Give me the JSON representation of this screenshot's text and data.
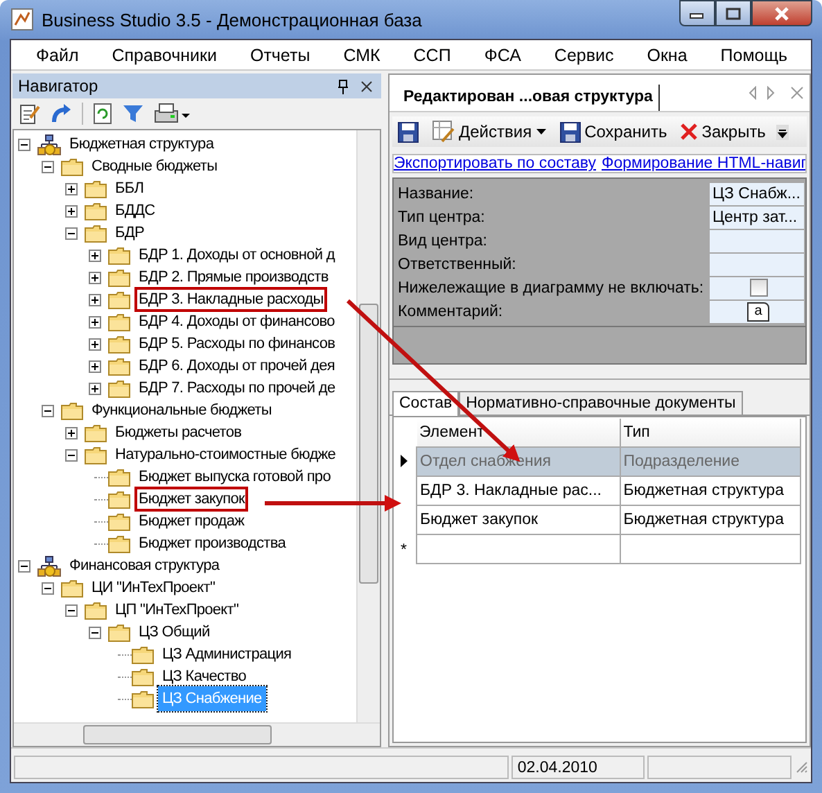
{
  "window": {
    "title": "Business Studio 3.5 - Демонстрационная база"
  },
  "menu": [
    "Файл",
    "Справочники",
    "Отчеты",
    "СМК",
    "ССП",
    "ФСА",
    "Сервис",
    "Окна",
    "Помощь"
  ],
  "navigator": {
    "title": "Навигатор",
    "tree": [
      {
        "label": "Бюджетная структура",
        "kind": "structure",
        "expanded": true,
        "selected": false,
        "highlighted": false,
        "children": [
          {
            "label": "Сводные бюджеты",
            "kind": "folder",
            "expanded": true,
            "selected": false,
            "highlighted": false,
            "children": [
              {
                "label": "ББЛ",
                "kind": "folder",
                "expanded": false,
                "selected": false,
                "highlighted": false
              },
              {
                "label": "БДДС",
                "kind": "folder",
                "expanded": false,
                "selected": false,
                "highlighted": false
              },
              {
                "label": "БДР",
                "kind": "folder",
                "expanded": true,
                "selected": false,
                "highlighted": false,
                "children": [
                  {
                    "label": "БДР 1. Доходы от основной д",
                    "kind": "folder",
                    "expanded": false,
                    "selected": false,
                    "highlighted": false
                  },
                  {
                    "label": "БДР 2. Прямые производств",
                    "kind": "folder",
                    "expanded": false,
                    "selected": false,
                    "highlighted": false
                  },
                  {
                    "label": "БДР 3. Накладные расходы",
                    "kind": "folder",
                    "expanded": false,
                    "selected": false,
                    "highlighted": true
                  },
                  {
                    "label": "БДР 4. Доходы от финансово",
                    "kind": "folder",
                    "expanded": false,
                    "selected": false,
                    "highlighted": false
                  },
                  {
                    "label": "БДР 5. Расходы по финансов",
                    "kind": "folder",
                    "expanded": false,
                    "selected": false,
                    "highlighted": false
                  },
                  {
                    "label": "БДР 6. Доходы от прочей дея",
                    "kind": "folder",
                    "expanded": false,
                    "selected": false,
                    "highlighted": false
                  },
                  {
                    "label": "БДР 7. Расходы по прочей де",
                    "kind": "folder",
                    "expanded": false,
                    "selected": false,
                    "highlighted": false
                  }
                ]
              }
            ]
          },
          {
            "label": "Функциональные бюджеты",
            "kind": "folder",
            "expanded": true,
            "selected": false,
            "highlighted": false,
            "children": [
              {
                "label": "Бюджеты расчетов",
                "kind": "folder",
                "expanded": false,
                "selected": false,
                "highlighted": false
              },
              {
                "label": "Натурально-стоимостные бюдже",
                "kind": "folder",
                "expanded": true,
                "selected": false,
                "highlighted": false,
                "children": [
                  {
                    "label": "Бюджет выпуска готовой про",
                    "kind": "leaf",
                    "selected": false,
                    "highlighted": false
                  },
                  {
                    "label": "Бюджет закупок",
                    "kind": "leaf",
                    "selected": false,
                    "highlighted": true
                  },
                  {
                    "label": "Бюджет продаж",
                    "kind": "leaf",
                    "selected": false,
                    "highlighted": false
                  },
                  {
                    "label": "Бюджет производства",
                    "kind": "leaf",
                    "selected": false,
                    "highlighted": false
                  }
                ]
              }
            ]
          }
        ]
      },
      {
        "label": "Финансовая структура",
        "kind": "structure",
        "expanded": true,
        "selected": false,
        "highlighted": false,
        "children": [
          {
            "label": "ЦИ \"ИнТехПроект\"",
            "kind": "folder",
            "expanded": true,
            "selected": false,
            "highlighted": false,
            "children": [
              {
                "label": "ЦП \"ИнТехПроект\"",
                "kind": "folder",
                "expanded": true,
                "selected": false,
                "highlighted": false,
                "children": [
                  {
                    "label": "ЦЗ Общий",
                    "kind": "folder",
                    "expanded": true,
                    "selected": false,
                    "highlighted": false,
                    "children": [
                      {
                        "label": "ЦЗ Администрация",
                        "kind": "leaf",
                        "selected": false,
                        "highlighted": false
                      },
                      {
                        "label": "ЦЗ Качество",
                        "kind": "leaf",
                        "selected": false,
                        "highlighted": false
                      },
                      {
                        "label": "ЦЗ Снабжение",
                        "kind": "leaf",
                        "selected": true,
                        "highlighted": false
                      }
                    ]
                  }
                ]
              }
            ]
          }
        ]
      }
    ]
  },
  "document": {
    "tab": "Редактирован ...овая  структура",
    "toolbar": [
      {
        "kind": "save"
      },
      {
        "kind": "menu",
        "label": "Действия"
      },
      {
        "kind": "save",
        "label": "Сохранить"
      },
      {
        "kind": "close",
        "label": "Закрыть"
      }
    ],
    "links": [
      "Экспортировать по составу",
      "Формирование HTML-навиг"
    ],
    "properties": [
      {
        "label": "Название:",
        "kind": "text",
        "value": "ЦЗ Снабж..."
      },
      {
        "label": "Тип центра:",
        "kind": "text",
        "value": "Центр зат..."
      },
      {
        "label": "Вид центра:",
        "kind": "text"
      },
      {
        "label": "Ответственный:",
        "kind": "text"
      },
      {
        "label": "Нижележащие в диаграмму не включать:",
        "kind": "checkbox",
        "checked": false
      },
      {
        "label": "Комментарий:",
        "kind": "memo",
        "value": "a"
      }
    ],
    "tabs": [
      {
        "label": "Состав",
        "selected": true
      },
      {
        "label": "Нормативно-справочные документы",
        "selected": false
      }
    ],
    "table": {
      "columns": [
        "Элемент",
        "Тип"
      ],
      "rows": [
        {
          "cells": [
            "Отдел снабжения",
            "Подразделение"
          ],
          "selected": true
        },
        {
          "cells": [
            "БДР 3. Накладные рас...",
            "Бюджетная структура"
          ],
          "selected": false
        },
        {
          "cells": [
            "Бюджет закупок",
            "Бюджетная структура"
          ],
          "selected": false
        }
      ],
      "new_row_marker": "*"
    }
  },
  "status_bar": {
    "date": "02.04.2010"
  }
}
